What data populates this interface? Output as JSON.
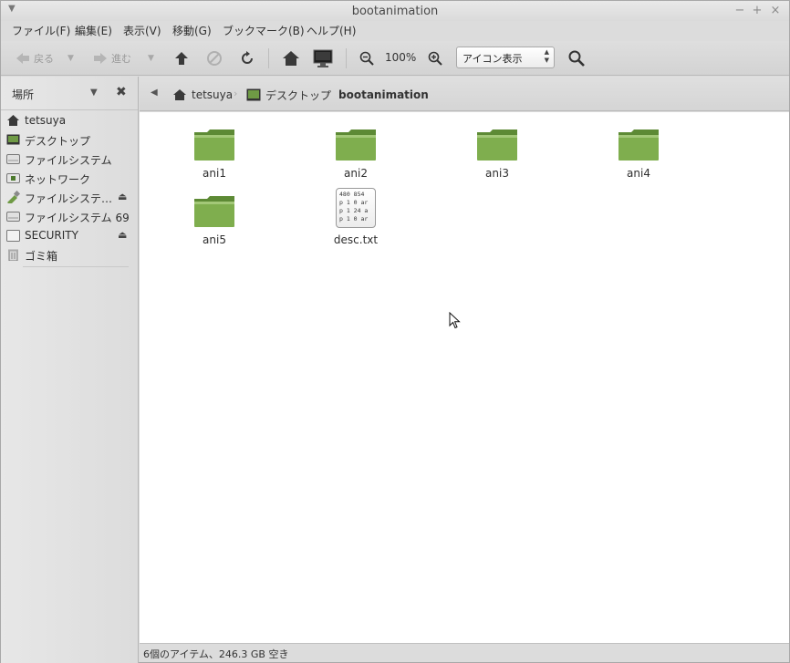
{
  "window": {
    "title": "bootanimation"
  },
  "menubar": {
    "items": [
      "ファイル(F)",
      "編集(E)",
      "表示(V)",
      "移動(G)",
      "ブックマーク(B)",
      "ヘルプ(H)"
    ]
  },
  "toolbar": {
    "back_label": "戻る",
    "forward_label": "進む",
    "zoom_level": "100%",
    "view_mode": "アイコン表示"
  },
  "sidebar": {
    "header": "場所",
    "items": [
      {
        "label": "tetsuya",
        "icon": "home-icon"
      },
      {
        "label": "デスクトップ",
        "icon": "desktop-icon"
      },
      {
        "label": "ファイルシステム",
        "icon": "drive-icon"
      },
      {
        "label": "ネットワーク",
        "icon": "network-icon"
      },
      {
        "label": "ファイルシステ…",
        "icon": "usb-drive-icon",
        "eject": true
      },
      {
        "label": "ファイルシステム 69…",
        "icon": "drive-icon"
      },
      {
        "label": "SECURITY",
        "icon": "drive-icon",
        "eject": true
      },
      {
        "label": "ゴミ箱",
        "icon": "trash-icon"
      }
    ]
  },
  "pathbar": {
    "crumbs": [
      "tetsuya",
      "デスクトップ",
      "bootanimation"
    ]
  },
  "files": [
    {
      "name": "ani1",
      "type": "folder"
    },
    {
      "name": "ani2",
      "type": "folder"
    },
    {
      "name": "ani3",
      "type": "folder"
    },
    {
      "name": "ani4",
      "type": "folder"
    },
    {
      "name": "ani5",
      "type": "folder"
    },
    {
      "name": "desc.txt",
      "type": "text",
      "preview": [
        "480 854",
        "p 1 0 ar",
        "p 1 24 a",
        "p 1 0 ar"
      ]
    }
  ],
  "status": "6個のアイテム、246.3 GB 空き",
  "colors": {
    "folder": "#7fae4e",
    "folder_dark": "#5d8a35",
    "accent": "#6f9a45"
  }
}
